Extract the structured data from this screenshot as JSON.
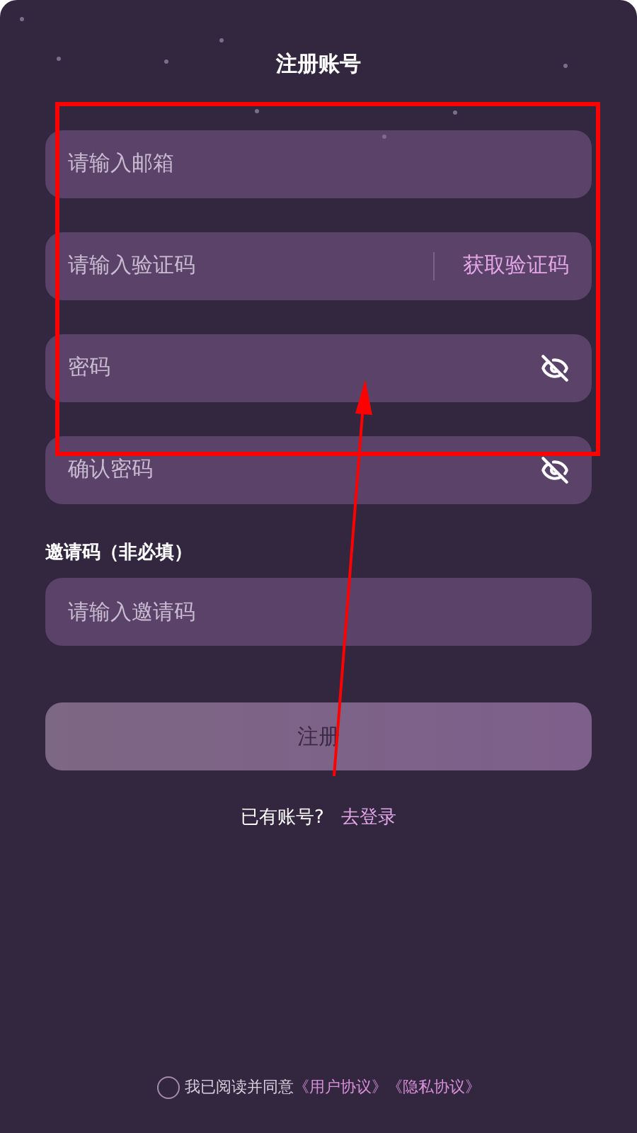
{
  "title": "注册账号",
  "fields": [
    {
      "kind": "text",
      "placeholder": "请输入邮箱"
    },
    {
      "kind": "code",
      "placeholder": "请输入验证码",
      "action": "获取验证码"
    },
    {
      "kind": "password",
      "placeholder": "密码"
    },
    {
      "kind": "password",
      "placeholder": "确认密码"
    }
  ],
  "invite": {
    "label": "邀请码（非必填）",
    "placeholder": "请输入邀请码"
  },
  "register_button": "注册",
  "login_prompt": {
    "text": "已有账号?",
    "link": "去登录"
  },
  "agreement": {
    "checked": false,
    "text": "我已阅读并同意",
    "links": [
      "《用户协议》",
      "《隐私协议》"
    ]
  }
}
